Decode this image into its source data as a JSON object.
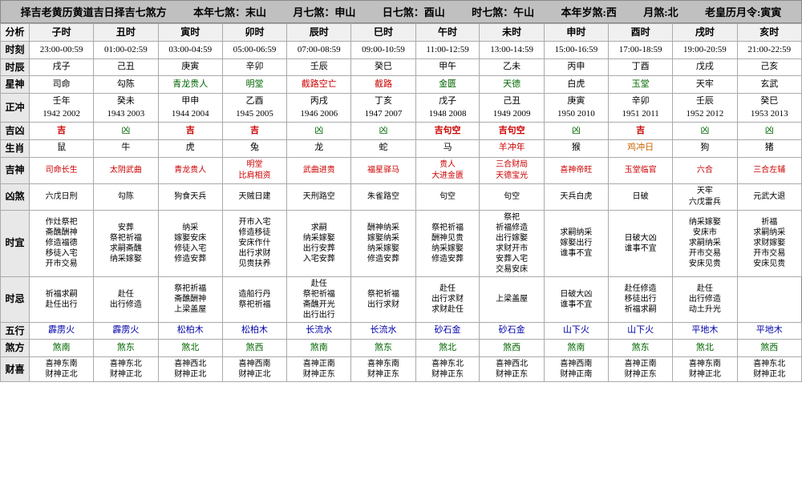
{
  "header": {
    "title": "择吉老黄历黄道吉日择吉七煞方",
    "items": [
      "本年七煞：末山",
      "月七煞：申山",
      "日七煞：酉山",
      "时七煞：午山",
      "本年岁煞:西",
      "月煞:北",
      "老皇历月令:寅寅"
    ]
  },
  "columns": [
    {
      "id": "fenxi",
      "label": "分析"
    },
    {
      "id": "zi",
      "label": "子时"
    },
    {
      "id": "chou",
      "label": "丑时"
    },
    {
      "id": "yin",
      "label": "寅时"
    },
    {
      "id": "mao",
      "label": "卯时"
    },
    {
      "id": "chen",
      "label": "辰时"
    },
    {
      "id": "si",
      "label": "巳时"
    },
    {
      "id": "wu",
      "label": "午时"
    },
    {
      "id": "wei",
      "label": "未时"
    },
    {
      "id": "shen",
      "label": "申时"
    },
    {
      "id": "you",
      "label": "酉时"
    },
    {
      "id": "xu",
      "label": "戌时"
    },
    {
      "id": "hai",
      "label": "亥时"
    }
  ],
  "rows": [
    {
      "label": "时刻",
      "cells": [
        "23:00-00:59",
        "01:00-02:59",
        "03:00-04:59",
        "05:00-06:59",
        "07:00-08:59",
        "09:00-10:59",
        "11:00-12:59",
        "13:00-14:59",
        "15:00-16:59",
        "17:00-18:59",
        "19:00-20:59",
        "21:00-22:59"
      ],
      "style": "normal"
    },
    {
      "label": "时辰",
      "cells": [
        "戌子",
        "己丑",
        "庚寅",
        "辛卯",
        "壬辰",
        "癸巳",
        "甲午",
        "乙未",
        "丙申",
        "丁酉",
        "戊戌",
        "己亥"
      ],
      "style": "normal"
    },
    {
      "label": "星神",
      "cells": [
        "司命",
        "勾陈",
        "青龙贵人",
        "明堂",
        "截路空亡",
        "截路",
        "金匮",
        "天德",
        "白虎",
        "玉堂",
        "天牢",
        "玄武"
      ],
      "style": "normal"
    },
    {
      "label": "正冲",
      "cells": [
        "壬年\n1942 2002",
        "癸未\n1943 2003",
        "甲申\n1944 2004",
        "乙酉\n1945 2005",
        "丙戌\n1946 2006",
        "丁亥\n1947 2007",
        "戊子\n1948 2008",
        "己丑\n1949 2009",
        "庚寅\n1950 2010",
        "辛卯\n1951 2011",
        "壬辰\n1952 2012",
        "癸巳\n1953 2013"
      ],
      "style": "normal"
    },
    {
      "label": "吉凶",
      "cells": [
        "吉",
        "凶",
        "吉",
        "吉",
        "凶",
        "凶",
        "吉句空",
        "吉句空",
        "凶",
        "吉",
        "凶",
        "凶"
      ],
      "style": "jixiong"
    },
    {
      "label": "生肖",
      "cells": [
        "鼠",
        "牛",
        "虎",
        "兔",
        "龙",
        "蛇",
        "马",
        "羊冲年",
        "猴",
        "鸡冲日",
        "狗",
        "猪"
      ],
      "style": "normal"
    },
    {
      "label": "吉神",
      "cells": [
        "司命长生",
        "太阴武曲",
        "青龙贵人",
        "明堂\n比肩相资",
        "武曲进贵",
        "福星驿马",
        "贵人\n大进金匮",
        "三合财局\n天德宝光",
        "喜神帝旺",
        "玉堂临官",
        "六合",
        "三合左辅"
      ],
      "style": "normal"
    },
    {
      "label": "凶煞",
      "cells": [
        "六戊日刑",
        "勾陈",
        "狗食天兵",
        "天贼日建",
        "天刑路空",
        "朱雀路空",
        "句空",
        "句空",
        "天兵白虎",
        "日破",
        "天牢\n六戊雷兵",
        "元武大退"
      ],
      "style": "normal"
    },
    {
      "label": "时宜",
      "cells": [
        "作灶祭祀\n斋醮酬神\n修造福德\n移徒入宅\n开市交易",
        "安葬\n祭祀祈福\n求嗣斋醮\n纳采嫁娶",
        "纳采\n嫁娶安床\n修徒入宅\n修造安葬",
        "开市入宅\n修造移徒\n安床作什\n出行求财\n见贵扶养",
        "求嗣\n纳采嫁娶\n出行安葬\n入宅安葬",
        "酬神纳采\n嫁娶纳采\n纳采嫁娶\n修造安葬",
        "祭祀祈福\n酬神见贵\n纳采嫁娶\n修造安葬",
        "祭祀\n祈福修造\n出行嫁娶\n求财开市\n安葬入宅\n交易安床",
        "求嗣纳采\n嫁娶出行\n谁事不宜",
        "日破大凶\n谁事不宜",
        "纳采嫁娶\n安床市\n求嗣纳采\n开市交易\n安床见贵",
        "祈福\n求嗣纳采\n求财嫁娶\n开市交易\n安床见贵"
      ],
      "style": "normal"
    },
    {
      "label": "时忌",
      "cells": [
        "祈福求嗣\n赴任出行",
        "赴任\n出行修造",
        "祭祀祈福\n斋醮酬神\n上梁盖屋",
        "造船行丹\n祭祀祈福",
        "赴任\n祭祀祈福\n斋醮开光\n出行出行",
        "祭祀祈福\n出行求财",
        "赴任\n出行求财\n求财赴任",
        "上梁盖屋",
        "日破大凶\n谁事不宜",
        "赴任修造\n移徒出行\n祈福求嗣",
        "赴任\n出行修造\n动土升光"
      ],
      "style": "normal"
    },
    {
      "label": "五行",
      "cells": [
        "霹雳火",
        "霹雳火",
        "松柏木",
        "松柏木",
        "长流水",
        "长流水",
        "砂石金",
        "砂石金",
        "山下火",
        "山下火",
        "平地木",
        "平地木"
      ],
      "style": "wuxing"
    },
    {
      "label": "煞方",
      "cells": [
        "煞南",
        "煞东",
        "煞北",
        "煞西",
        "煞南",
        "煞东",
        "煞北",
        "煞西",
        "煞南",
        "煞东",
        "煞北",
        "煞西"
      ],
      "style": "normal"
    },
    {
      "label": "财喜",
      "cells": [
        "喜神东南\n财神正北",
        "喜神东北\n财神正北",
        "喜神西北\n财神正北",
        "喜神西南\n财神正北",
        "喜神正南\n财神正东",
        "喜神东南\n财神正东",
        "喜神东北\n财神正东",
        "喜神西北\n财神正东",
        "喜神西南\n财神正南",
        "喜神正南\n财神正东",
        "喜神东南\n财神正北",
        "喜神东北\n财神正北"
      ],
      "style": "normal"
    }
  ]
}
